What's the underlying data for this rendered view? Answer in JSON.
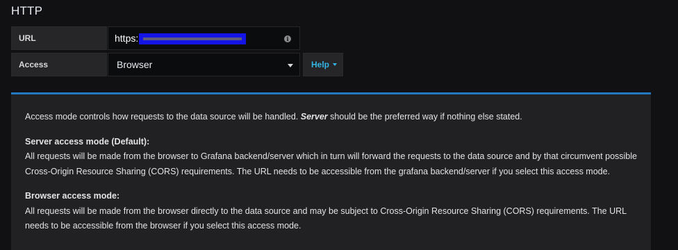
{
  "section": {
    "title": "HTTP"
  },
  "url_field": {
    "label": "URL",
    "value": "https:",
    "icon": "info-icon"
  },
  "access_field": {
    "label": "Access",
    "selected": "Browser",
    "icon": "caret-down-icon"
  },
  "help_button": {
    "label": "Help",
    "icon": "caret-down-icon"
  },
  "help_panel": {
    "intro_before": "Access mode controls how requests to the data source will be handled. ",
    "intro_emphasis": "Server",
    "intro_after": " should be the preferred way if nothing else stated.",
    "server_heading": "Server access mode (Default):",
    "server_body": "All requests will be made from the browser to Grafana backend/server which in turn will forward the requests to the data source and by that circumvent possible Cross-Origin Resource Sharing (CORS) requirements. The URL needs to be accessible from the grafana backend/server if you select this access mode.",
    "browser_heading": "Browser access mode:",
    "browser_body": "All requests will be made from the browser directly to the data source and may be subject to Cross-Origin Resource Sharing (CORS) requirements. The URL needs to be accessible from the browser if you select this access mode."
  },
  "colors": {
    "accent": "#1f78c1",
    "link": "#33b5e5",
    "redaction": "#1414e6",
    "background": "#111113",
    "panel": "#212124"
  }
}
